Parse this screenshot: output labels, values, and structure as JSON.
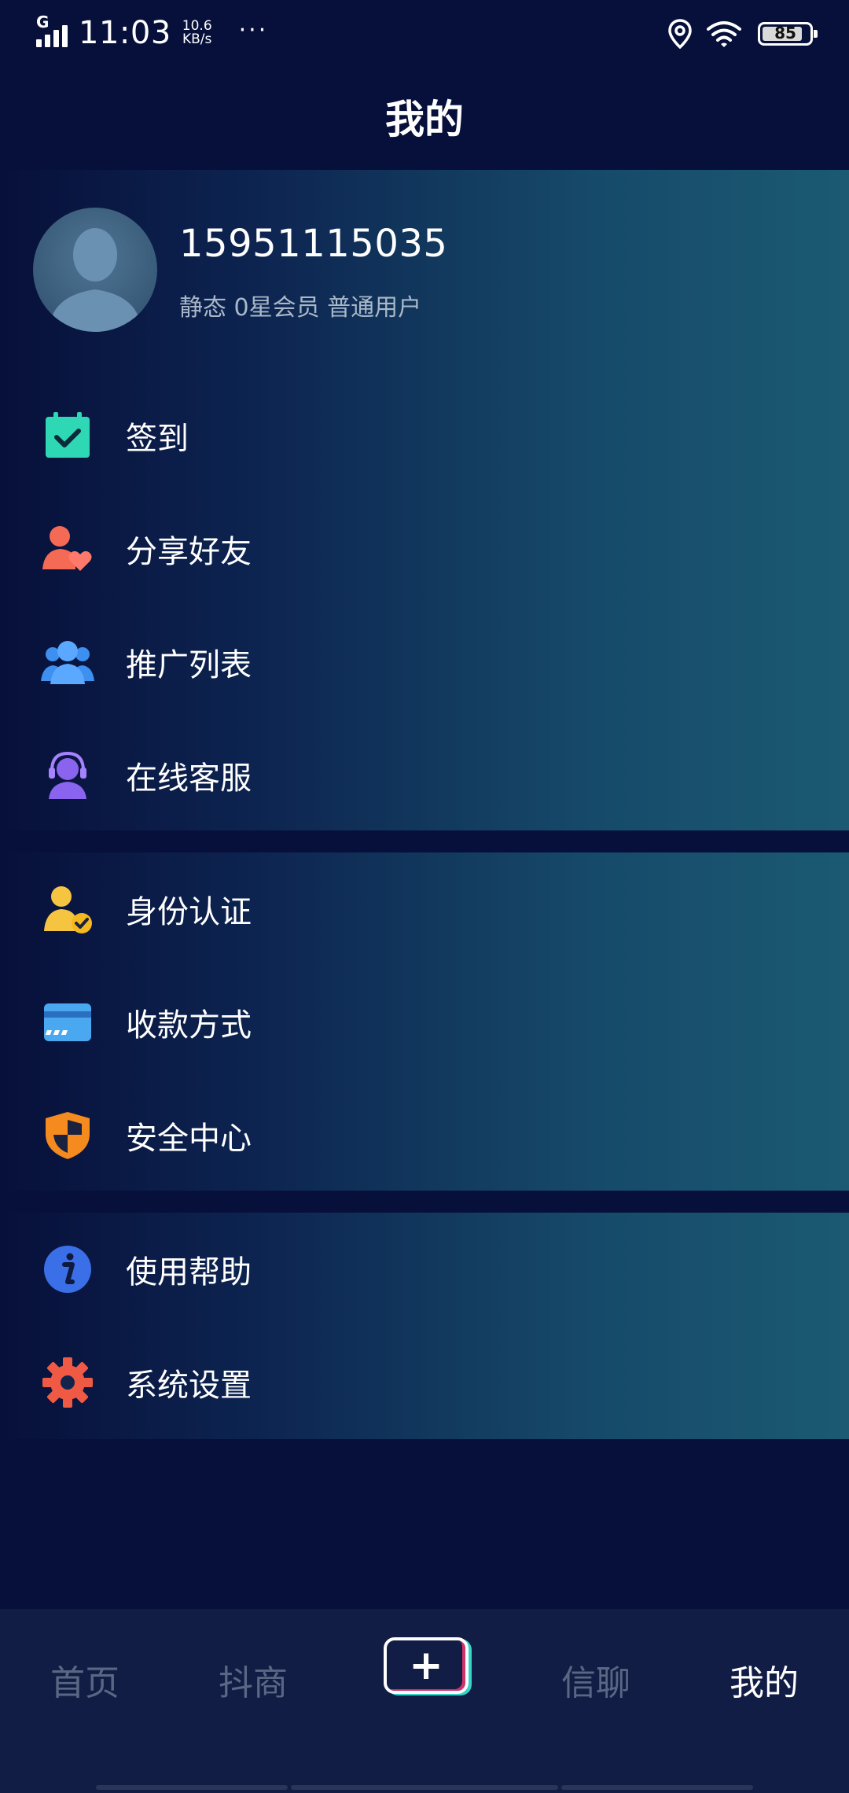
{
  "status_bar": {
    "network": "G",
    "time": "11:03",
    "speed_value": "10.6",
    "speed_unit": "KB/s",
    "more": "···",
    "battery": "85"
  },
  "page": {
    "title": "我的"
  },
  "profile": {
    "phone": "15951115035",
    "member_info": "静态 0星会员 普通用户"
  },
  "menu": {
    "group1": [
      {
        "label": "签到",
        "icon": "calendar-check-icon",
        "color": "#2fd8b4"
      },
      {
        "label": "分享好友",
        "icon": "user-heart-icon",
        "color": "#f46a55"
      },
      {
        "label": "推广列表",
        "icon": "user-group-icon",
        "color": "#3d8ff0"
      },
      {
        "label": "在线客服",
        "icon": "headset-icon",
        "color": "#8a63ef"
      }
    ],
    "group2": [
      {
        "label": "身份认证",
        "icon": "user-verified-icon",
        "color": "#f5c542"
      },
      {
        "label": "收款方式",
        "icon": "credit-card-icon",
        "color": "#4aa8f0"
      },
      {
        "label": "安全中心",
        "icon": "shield-icon",
        "color": "#f58a1f"
      }
    ],
    "group3": [
      {
        "label": "使用帮助",
        "icon": "info-icon",
        "color": "#3b6fe8"
      },
      {
        "label": "系统设置",
        "icon": "gear-icon",
        "color": "#f05a45"
      }
    ]
  },
  "tabbar": {
    "tabs": [
      {
        "label": "首页",
        "active": false
      },
      {
        "label": "抖商",
        "active": false
      },
      {
        "label": "+",
        "active": false
      },
      {
        "label": "信聊",
        "active": false
      },
      {
        "label": "我的",
        "active": true
      }
    ]
  }
}
